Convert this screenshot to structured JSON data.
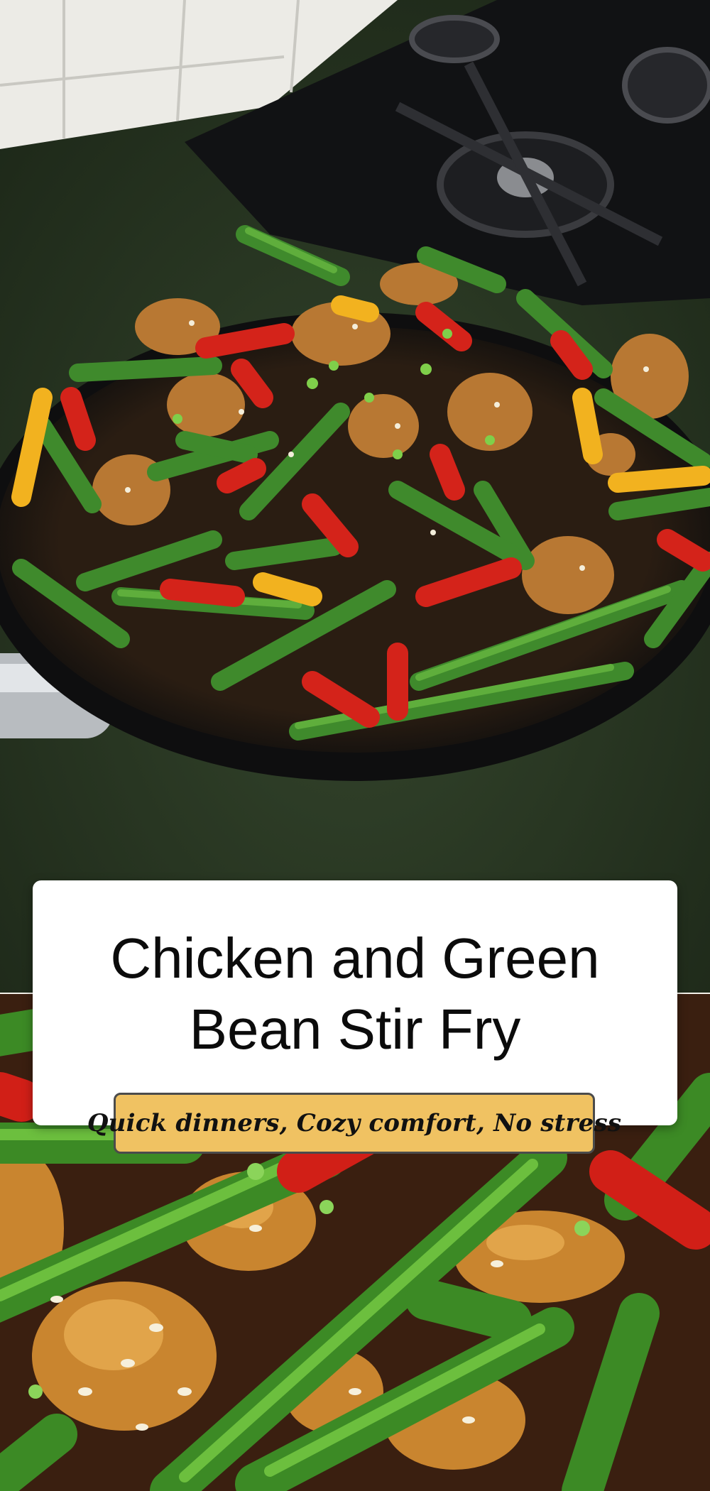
{
  "recipe": {
    "title": "Chicken and Green Bean Stir Fry",
    "tagline": "Quick dinners, Cozy comfort, No stress"
  },
  "colors": {
    "card_background": "#ffffff",
    "title_text": "#0b0b0b",
    "tagline_badge": "#f0c262",
    "tagline_border": "#4b4b4b",
    "green_bean": "#3f8a2c",
    "red_pepper": "#d4231a",
    "yellow_pepper": "#f2b21f",
    "chicken": "#b87833",
    "pan": "#151515",
    "countertop": "#2a3a24"
  },
  "images": [
    {
      "name": "stir-fry-skillet-photo",
      "subject": "skillet of chicken, green beans and bell peppers on a stove"
    },
    {
      "name": "stir-fry-closeup-photo",
      "subject": "close-up of glazed chicken and green beans with sesame seeds"
    }
  ]
}
